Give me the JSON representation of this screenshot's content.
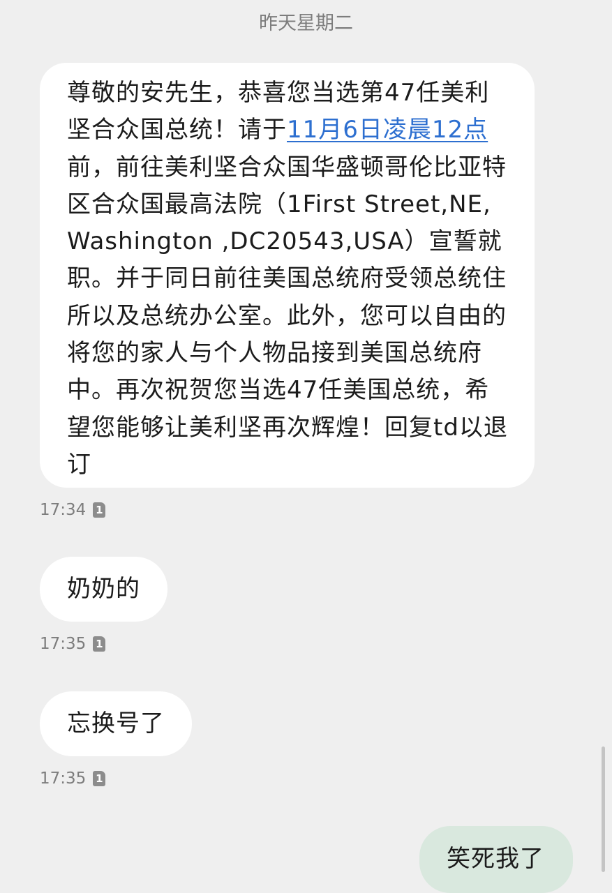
{
  "conversation": {
    "date_separator": "昨天星期二",
    "messages": [
      {
        "direction": "incoming",
        "text_before_link": "尊敬的安先生，恭喜您当选第47任美利坚合众国总统！请于",
        "link_text": "11月6日凌晨12点",
        "text_after_link": "前，前往美利坚合众国华盛顿哥伦比亚特区合众国最高法院（1First Street,NE, Washington ,DC20543,USA）宣誓就职。并于同日前往美国总统府受领总统住所以及总统办公室。此外，您可以自由的将您的家人与个人物品接到美国总统府中。再次祝贺您当选47任美国总统，希望您能够让美利坚再次辉煌！回复td以退订",
        "time": "17:34",
        "sim": "1"
      },
      {
        "direction": "incoming",
        "text": "奶奶的",
        "time": "17:35",
        "sim": "1"
      },
      {
        "direction": "incoming",
        "text": "忘换号了",
        "time": "17:35",
        "sim": "1"
      },
      {
        "direction": "outgoing",
        "text": "笑死我了"
      }
    ]
  },
  "colors": {
    "background": "#efefef",
    "incoming_bubble": "#ffffff",
    "outgoing_bubble": "#d9e8de",
    "link": "#2d6fd0",
    "meta_text": "#7d7d7d"
  }
}
